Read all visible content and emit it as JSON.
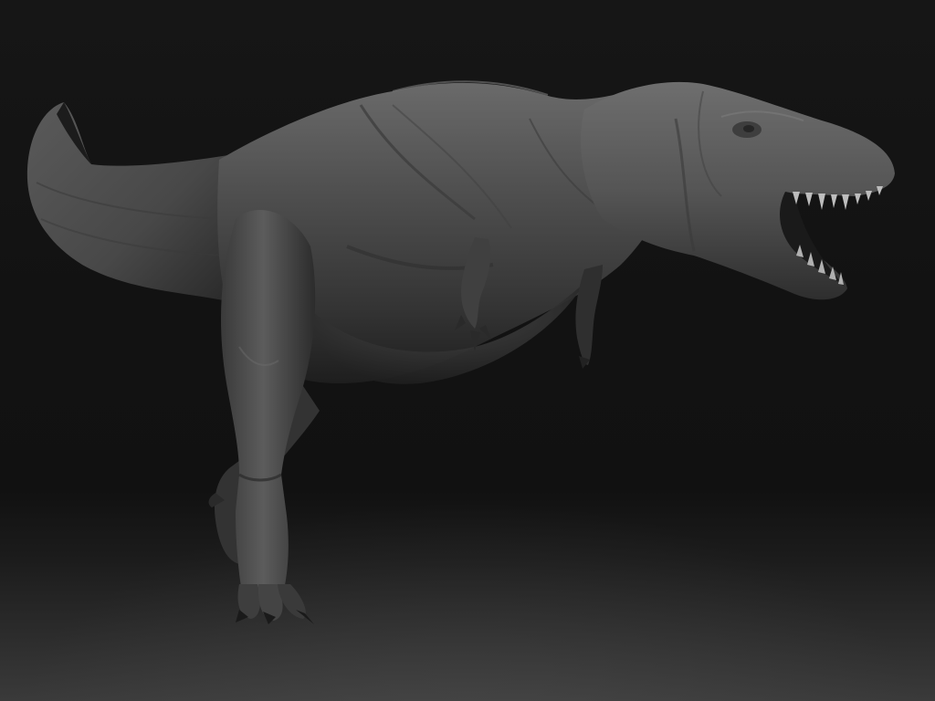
{
  "scene": {
    "subject": "t-rex-sculpt",
    "colors": {
      "background_top": "#161616",
      "background_bottom": "#3a3a3a",
      "clay_light": "#7a7a7a",
      "clay_mid": "#4e4e4e",
      "clay_dark": "#222222",
      "teeth": "#bdbdbd"
    }
  }
}
